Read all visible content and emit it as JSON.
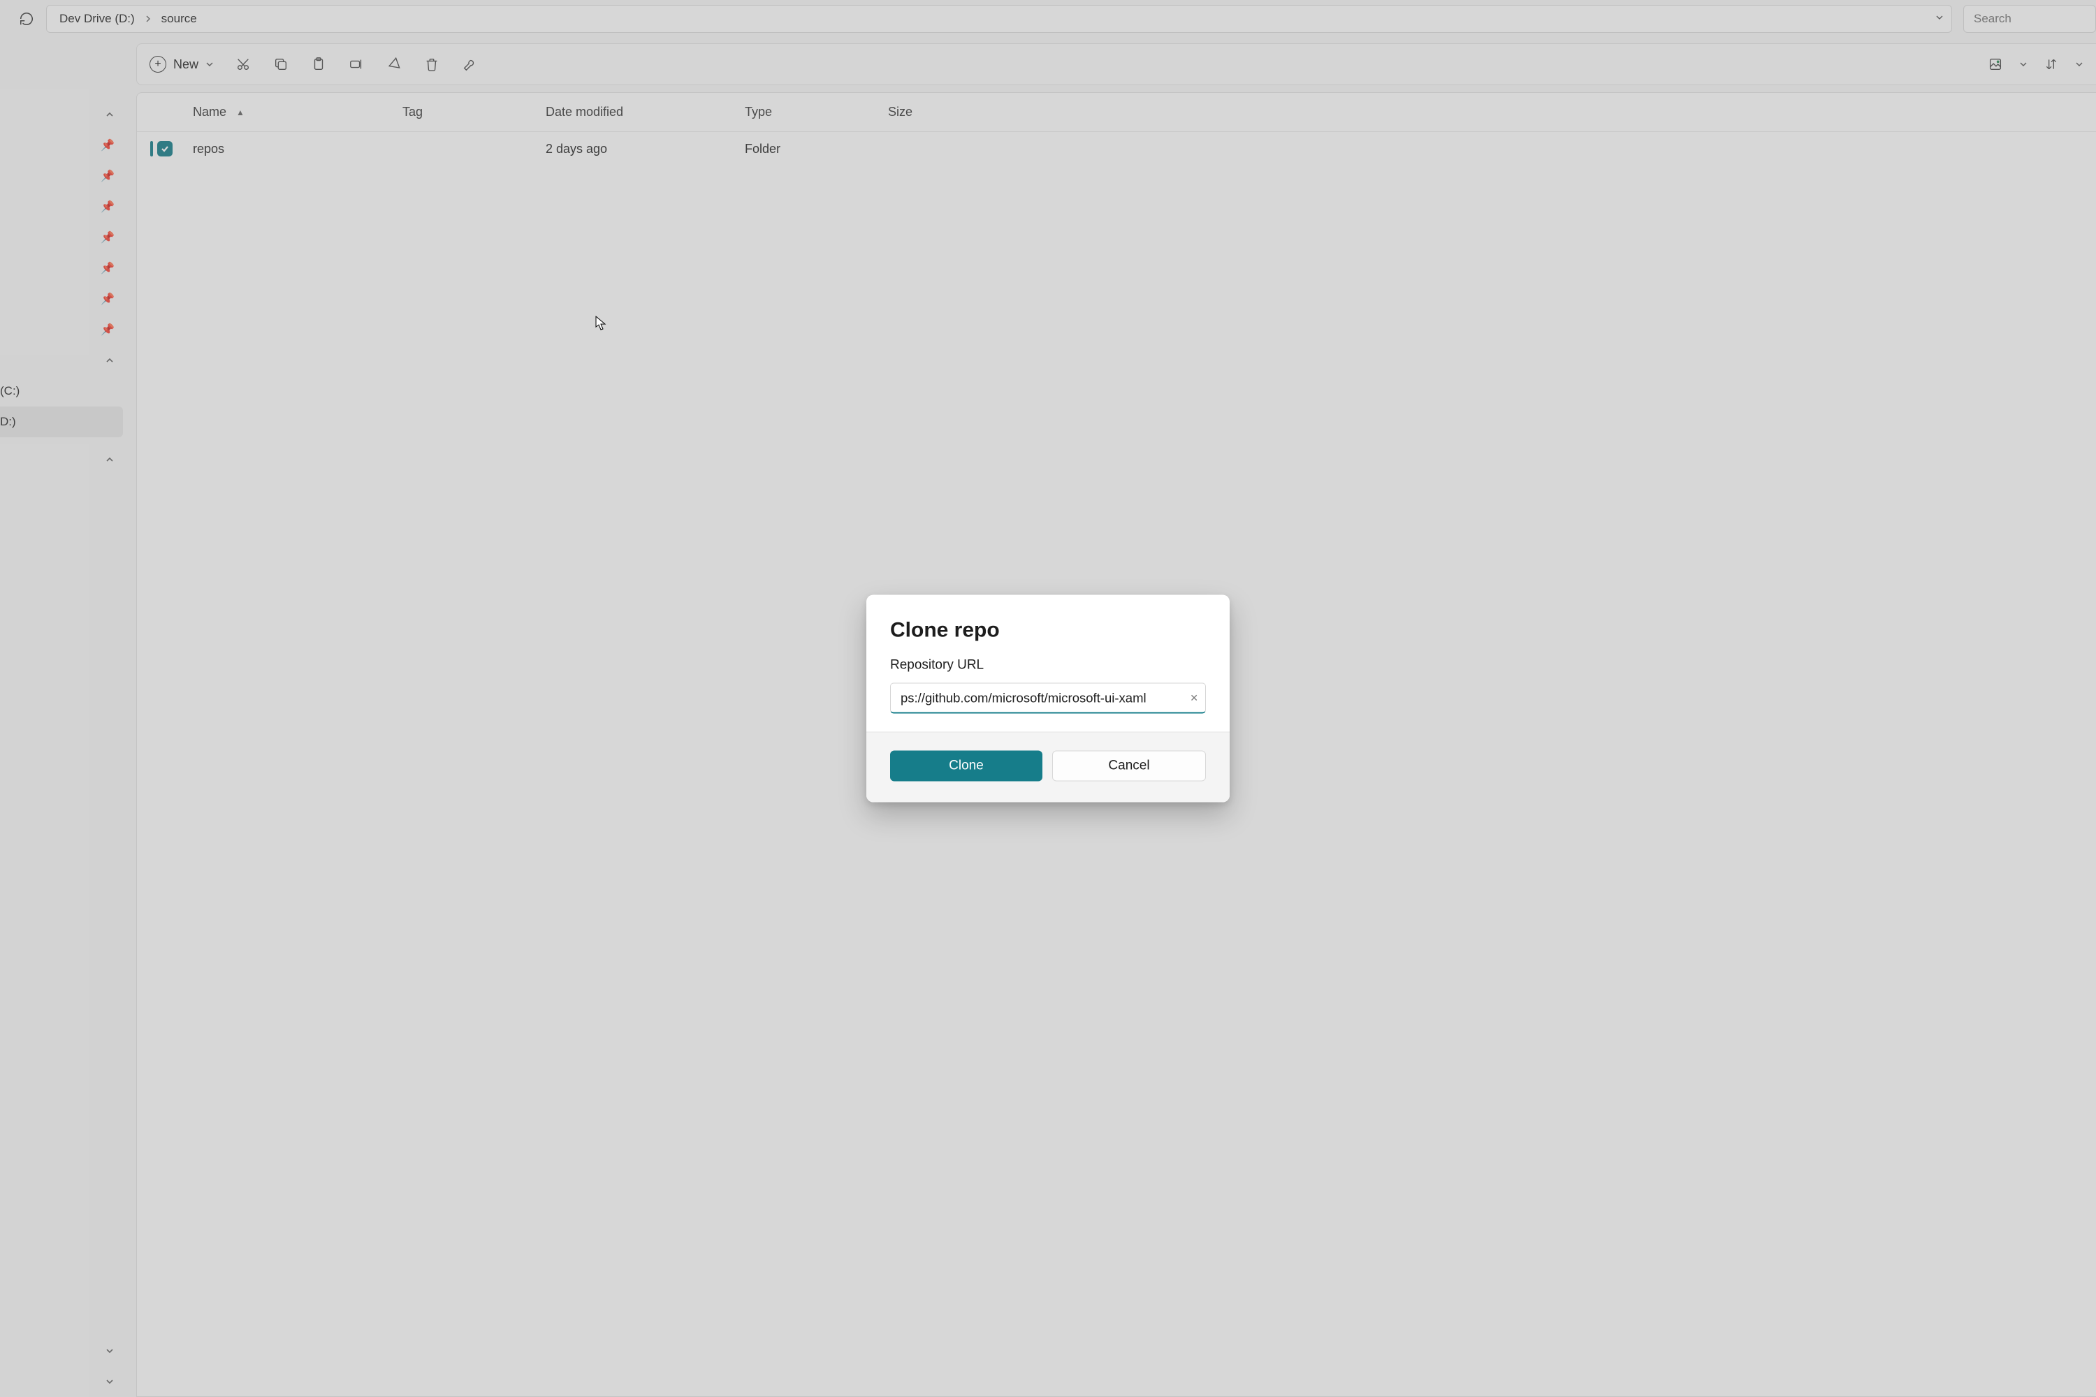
{
  "breadcrumb": {
    "root": "Dev Drive (D:)",
    "segment": "source"
  },
  "search_placeholder": "Search",
  "toolbar": {
    "new_label": "New"
  },
  "columns": {
    "name": "Name",
    "tag": "Tag",
    "date": "Date modified",
    "type": "Type",
    "size": "Size"
  },
  "rows": [
    {
      "name": "repos",
      "date": "2 days ago",
      "type": "Folder"
    }
  ],
  "sidebar": {
    "drive_c": "(C:)",
    "drive_d": "D:)"
  },
  "dialog": {
    "title": "Clone repo",
    "label": "Repository URL",
    "url": "ps://github.com/microsoft/microsoft-ui-xaml",
    "primary": "Clone",
    "secondary": "Cancel"
  }
}
